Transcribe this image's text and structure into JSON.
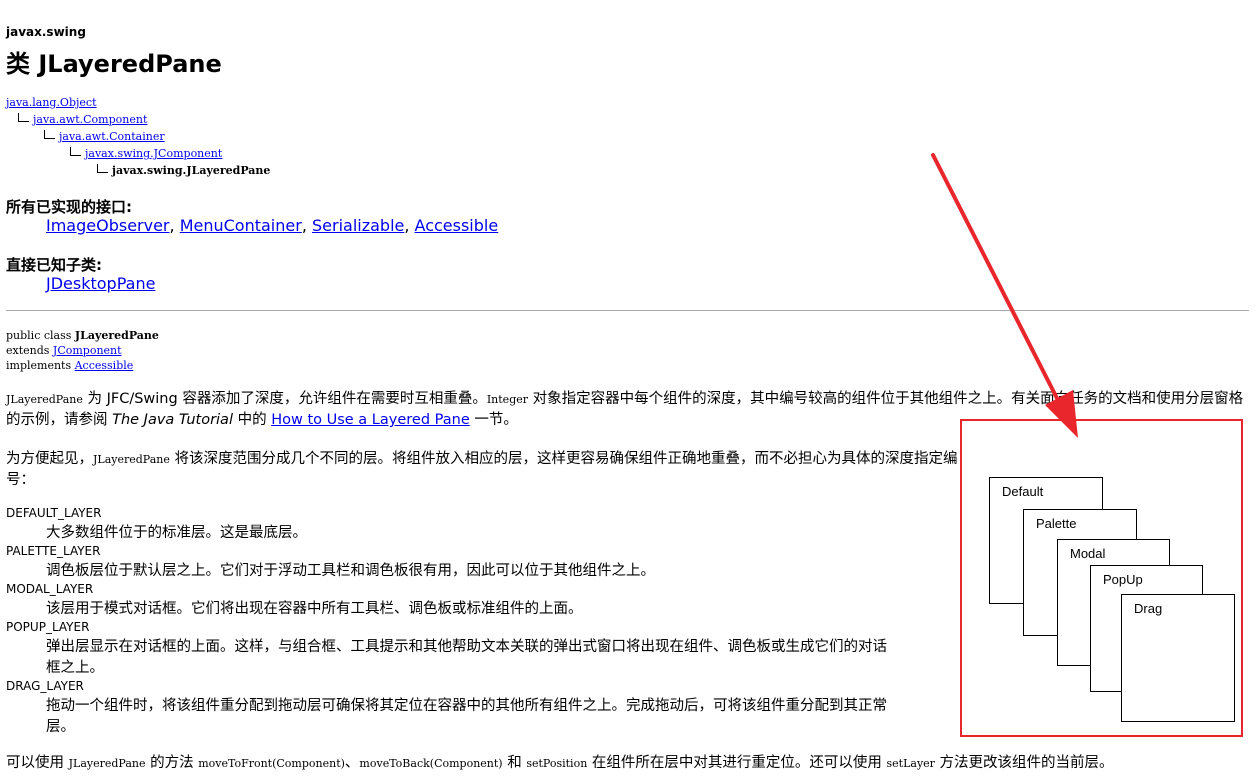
{
  "package": "javax.swing",
  "title": "类 JLayeredPane",
  "hierarchy": [
    "java.lang.Object",
    "java.awt.Component",
    "java.awt.Container",
    "javax.swing.JComponent",
    "javax.swing.JLayeredPane"
  ],
  "interfaces": {
    "heading": "所有已实现的接口:",
    "items": [
      "ImageObserver",
      "MenuContainer",
      "Serializable",
      "Accessible"
    ],
    "separator": ", "
  },
  "subclasses": {
    "heading": "直接已知子类:",
    "items": [
      "JDesktopPane"
    ]
  },
  "declaration": {
    "line1_prefix": "public class ",
    "line1_name": "JLayeredPane",
    "line2_prefix": "extends ",
    "line2_link": "JComponent",
    "line3_prefix": "implements ",
    "line3_link": "Accessible"
  },
  "intro": {
    "code1": "JLayeredPane",
    "text1": " 为 JFC/Swing 容器添加了深度，允许组件在需要时互相重叠。",
    "code2": "Integer",
    "text2": " 对象指定容器中每个组件的深度，其中编号较高的组件位于其他组件之上。有关面向任务的文档和使用分层窗格的示例，请参阅 ",
    "tutorial": "The Java Tutorial",
    "text3": " 中的 ",
    "link": "How to Use a Layered Pane",
    "text4": " 一节。"
  },
  "convenience": {
    "text1": "为方便起见，",
    "code1": "JLayeredPane",
    "text2": " 将该深度范围分成几个不同的层。将组件放入相应的层，这样更容易确保组件正确地重叠，而不必担心为具体的深度指定编号："
  },
  "layers": [
    {
      "term": "DEFAULT_LAYER",
      "desc": "大多数组件位于的标准层。这是最底层。"
    },
    {
      "term": "PALETTE_LAYER",
      "desc": "调色板层位于默认层之上。它们对于浮动工具栏和调色板很有用，因此可以位于其他组件之上。"
    },
    {
      "term": "MODAL_LAYER",
      "desc": "该层用于模式对话框。它们将出现在容器中所有工具栏、调色板或标准组件的上面。"
    },
    {
      "term": "POPUP_LAYER",
      "desc1": "弹出层显示在对话框的上面。这样，与组合框、工具提示和其他帮助文本关联的弹出式窗口将出现在组件、调色板或生成它们的对话",
      "desc2": "框之上。"
    },
    {
      "term": "DRAG_LAYER",
      "desc1": "拖动一个组件时，将该组件重分配到拖动层可确保将其定位在容器中的其他所有组件之上。完成拖动后，可将该组件重分配到其正常",
      "desc2": "层。"
    }
  ],
  "footer": {
    "text1": "可以使用 ",
    "code1": "JLayeredPane",
    "text2": " 的方法 ",
    "code2": "moveToFront(Component)",
    "text3": "、",
    "code3": "moveToBack(Component)",
    "text4": " 和 ",
    "code4": "setPosition",
    "text5": " 在组件所在层中对其进行重定位。还可以使用 ",
    "code5": "setLayer",
    "text6": " 方法更改该组件的当前层。"
  },
  "diagram": {
    "labels": [
      "Default",
      "Palette",
      "Modal",
      "PopUp",
      "Drag"
    ],
    "highlight_color": "#e8262b"
  }
}
